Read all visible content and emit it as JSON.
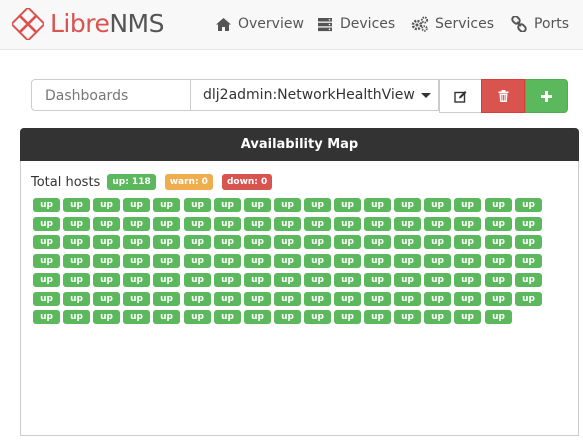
{
  "brand": {
    "part1": "Libre",
    "part2": "NMS"
  },
  "nav": [
    {
      "label": "Overview",
      "icon": "home-icon"
    },
    {
      "label": "Devices",
      "icon": "server-icon"
    },
    {
      "label": "Services",
      "icon": "cogs-icon"
    },
    {
      "label": "Ports",
      "icon": "link-icon"
    }
  ],
  "dashboard": {
    "label": "Dashboards",
    "selected": "dlj2admin:NetworkHealthView",
    "edit_icon": "edit-icon",
    "delete_icon": "trash-icon",
    "add_icon": "plus-icon"
  },
  "widget": {
    "title": "Availability Map",
    "total_label": "Total hosts",
    "up_badge": "up: 118",
    "warn_badge": "warn: 0",
    "down_badge": "down: 0",
    "host_label": "up",
    "host_count": 118,
    "colors": {
      "up": "#5cb85c",
      "warn": "#f0ad4e",
      "down": "#d9534f"
    }
  }
}
